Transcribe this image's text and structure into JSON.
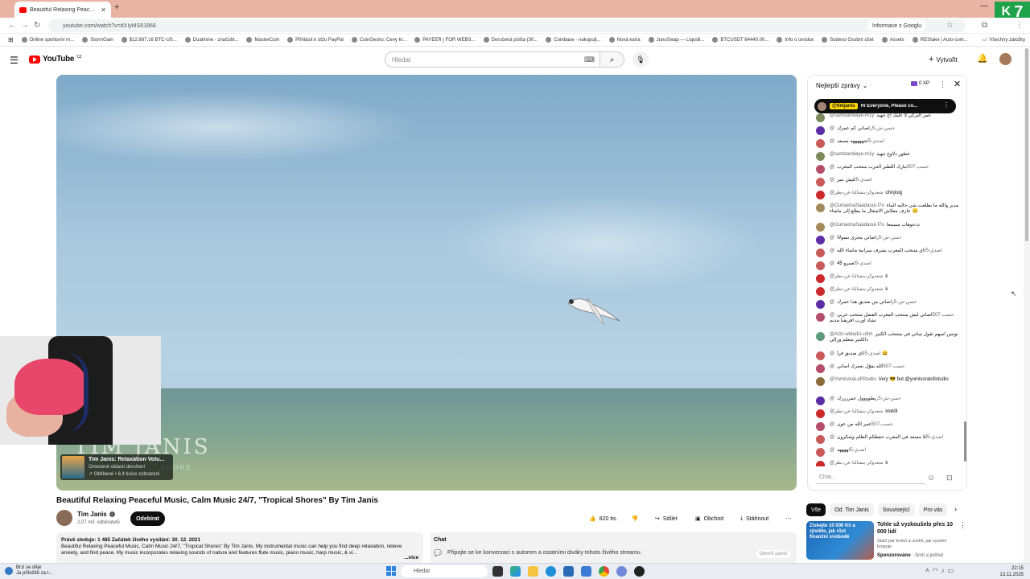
{
  "browser": {
    "tab_title": "Beautiful Relaxing Peaceful Mu",
    "url": "youtube.com/watch?v=dXIyMS61868",
    "info_button": "Informace z Googlu",
    "bookmarks": [
      "Online sportovní m...",
      "StormGain",
      "$12,887.16 BTC-US...",
      "Dualmine - značobt...",
      "MasterCoin",
      "Přihlásit k účtu PayPal",
      "CoinGecko: Ceny kr...",
      "PAYEER | FOR WEBS...",
      "Doručená pošta (30...",
      "Coinbase - nakupujt...",
      "Nová karta",
      "JunoSwap — Liquidi...",
      "BTCUSDT 64440.00...",
      "Info o úvodce",
      "Sodexo Osobní účet",
      "Assets",
      "RESIake | Auto-com..."
    ],
    "bookmarks_all": "Všechny záložky",
    "corner_logo": "7"
  },
  "header": {
    "logo_text": "YouTube",
    "logo_country": "CZ",
    "search_placeholder": "Hledat",
    "create_label": "Vytvořit"
  },
  "video": {
    "watermark": "TIM JANIS",
    "watermark_sub": "SHORE",
    "promo_title": "Tim Janis: Relaxation Volu...",
    "promo_sub1": "Omezené oblasti doručení",
    "promo_sub2": "↗ Oblíbené • 8,4 tisíce zobrazení"
  },
  "meta": {
    "title": "Beautiful Relaxing Peaceful Music, Calm Music 24/7, \"Tropical Shores\" By Tim Janis",
    "channel": "Tim Janis",
    "subscribers": "2,07 mil. odběratelů",
    "subscribe": "Odebírat",
    "likes": "820 tis.",
    "share": "Sdílet",
    "thanks": "Obchod",
    "download": "Stáhnout",
    "desc_stats": "Právě sleduje: 1 485  Začátek živého vysílání: 30. 12. 2021",
    "desc_text": "Beautiful Relaxing Peaceful Music, Calm Music 24/7, \"Tropical Shores\" By Tim Janis.  My instrumental music can help you find deep relaxation, relieve anxiety, and find peace. My music incorporates relaxing sounds of nature and features flute music, piano music, harp music, & vi...",
    "desc_more": "...více",
    "chat_title": "Chat",
    "chat_text": "Připojte se ke konverzaci s autorem a ostatními diváky tohoto živého streamu.",
    "chat_open": "Otevřít panel"
  },
  "chat": {
    "mode": "Nejlepší zprávy",
    "xp": "0 XP",
    "pinned_author": "@timjanis",
    "pinned_text": "Hi Everyone, Please co...",
    "input_placeholder": "Chat...",
    "messages": [
      {
        "author": "@sambandiaye-m1y",
        "text": "عمر التركي 3 عليك اخ جهيد",
        "color": "#7a8a5a"
      },
      {
        "author": "@حسن-ش-5ر",
        "text": "اصاتي كم عمرك",
        "color": "#5b2ea6"
      },
      {
        "author": "@اصدي-5ل",
        "text": "جهههههه مسعد",
        "color": "#c85a5a"
      },
      {
        "author": "@sambandiaye-m1y",
        "text": "عطور دلاوع جهيد",
        "color": "#7a8a5a"
      },
      {
        "author": "@حسب-507",
        "text": "تبارك اللطبر الحرب منتخب المغرب",
        "color": "#b44e6a"
      },
      {
        "author": "@اصدي-5ل",
        "text": "ليش بنيز",
        "color": "#c85a5a"
      },
      {
        "author": "@شعدوكر-يتشالبا-عن-بطر",
        "text": "ohnjioqj",
        "color": "#cc2a2a"
      },
      {
        "author": "@OumaimaSaadaoui-f7o",
        "text": "مدير والله ما بطلعت شي خاليه الماء عارف معلاش الاشغال ما يطلع إلى ماشاء 😊",
        "color": "#a48a5a",
        "tall": true
      },
      {
        "author": "@OumaimaSaadaoui-f7o",
        "text": "ددعوهات مسمعا",
        "color": "#a48a5a"
      },
      {
        "author": "@حسن-ش-5ر",
        "text": "اصاتي مجرى نسولاا",
        "color": "#5b2ea6"
      },
      {
        "author": "@اصدي-5ل",
        "text": "اي منتخب المغرب يشرف سرانية ماشاء الله",
        "color": "#c85a5a"
      },
      {
        "author": "@اصدي-5ل",
        "text": "عمرو 45",
        "color": "#c85a5a"
      },
      {
        "author": "@شعدوكر-يتشالبا-عن-بطر",
        "text": "k",
        "color": "#cc2a2a"
      },
      {
        "author": "@شعدوكر-يتشالبا-عن-بطر",
        "text": "k",
        "color": "#cc2a2a"
      },
      {
        "author": "@حسن-ش-5ر",
        "text": "اصاتي من صديق هدا عمرك",
        "color": "#5b2ea6"
      },
      {
        "author": "@حسب-507",
        "text": "اصاتي ليش منتخب المغرب الفضل منتخب عربي نشاد اورب افريقيا مديم",
        "color": "#b44e6a",
        "tall": true
      },
      {
        "author": "@Aziz-widadi1-u9m",
        "text": "تونس اسهم تقول ساتي في متنتخب الكنيز دالكتير متعلم ورالي",
        "color": "#5a9a7a",
        "tall": true
      },
      {
        "author": "@اصدي-5ل",
        "text": "اي صديق قرأ 😄",
        "color": "#c85a5a"
      },
      {
        "author": "@حسب-507",
        "text": "الله يقوّل بعمرك اصاتي",
        "color": "#b44e6a"
      },
      {
        "author": "@YumisoraLofiStudio",
        "text": "Very 😎 but @yumisoralofistudio",
        "color": "#8a6a3a",
        "tall": true
      },
      {
        "author": "@حسن-ش-5ر",
        "text": "يطوووول عمررررك",
        "color": "#5b2ea6"
      },
      {
        "author": "@شعدوكر-يتشالبا-عن-بطر",
        "text": "klokIll",
        "color": "#cc2a2a"
      },
      {
        "author": "@حسب-507",
        "text": "عمر الله من عون",
        "color": "#b44e6a"
      },
      {
        "author": "@اصدي-5ل",
        "text": "لا مسعد في المغرب حفظكم الظلم وشكرون",
        "color": "#c85a5a"
      },
      {
        "author": "@اصدي-5ل",
        "text": "ههههه",
        "color": "#c85a5a"
      },
      {
        "author": "@شعدوكر-يتشالبا-عن-بطر",
        "text": "k",
        "color": "#cc2a2a"
      }
    ]
  },
  "chips": [
    "Vše",
    "Od: Tim Janis",
    "Související",
    "Pro vás"
  ],
  "ad": {
    "thumb_text": "Získejte 10 000 Kč a zjistěte, jak růst finanční svobodě",
    "title": "Tohle už vyzkoušelo přes 10 000 lidí",
    "sub": "Stačí pár kroků a uvidíš, jak systém funguje",
    "sponsor_label": "Sponzorováno",
    "sponsor_name": "Smit a jednat"
  },
  "taskbar": {
    "weather_line1": "Brzi se děje",
    "weather_line2": "Ja příležitě za t...",
    "search_placeholder": "Hledat",
    "time": "22:15",
    "date": "13.11.2025"
  }
}
